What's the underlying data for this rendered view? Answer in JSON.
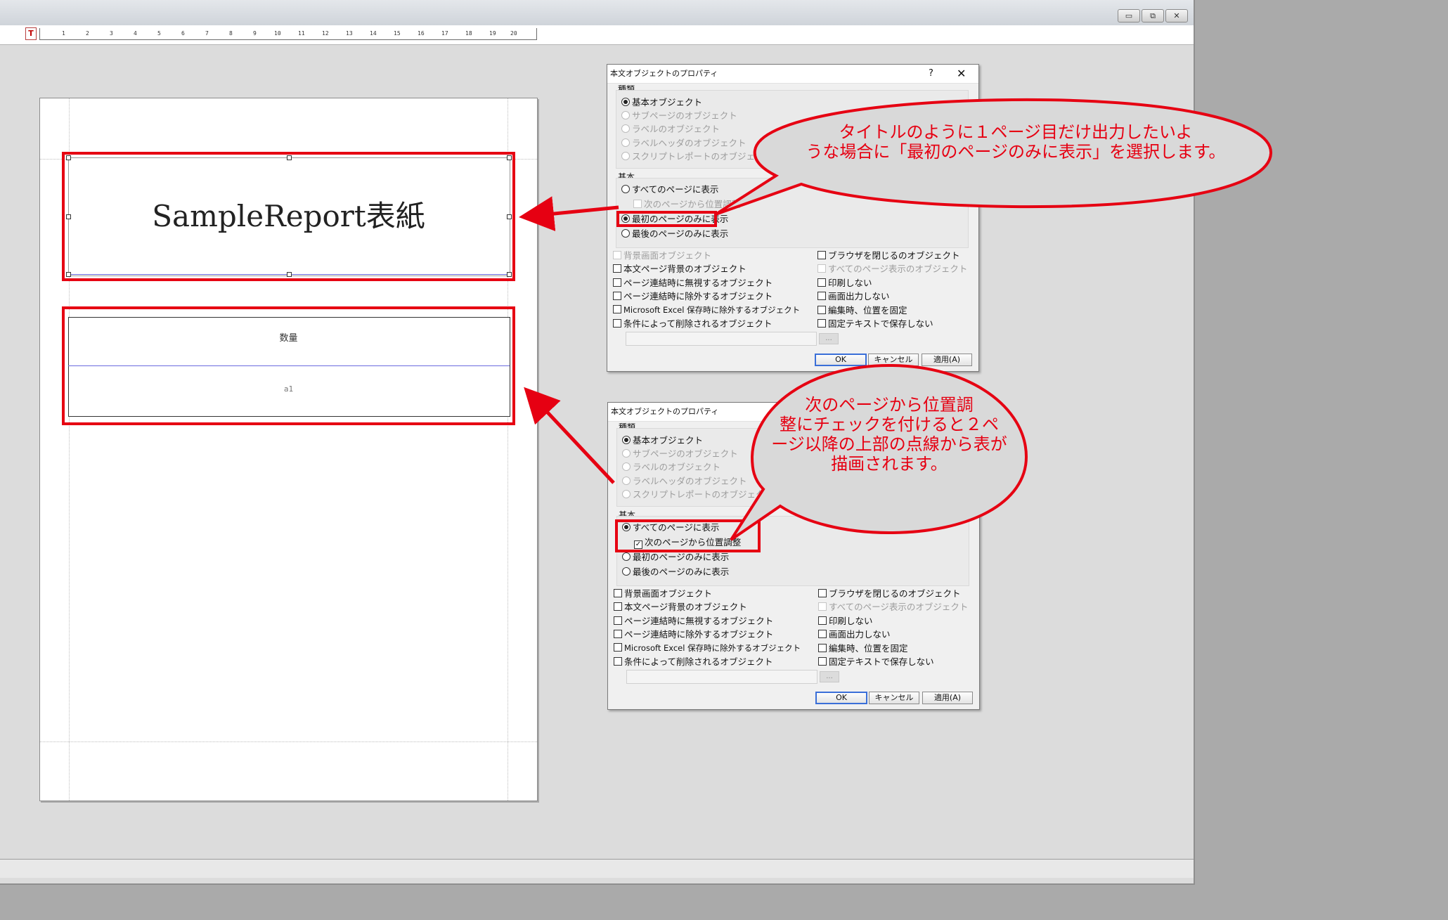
{
  "window": {
    "minimize_glyph": "▭",
    "restore_glyph": "⧉",
    "close_glyph": "✕"
  },
  "ruler": {
    "marker": "T",
    "ticks": [
      "1",
      "2",
      "3",
      "4",
      "5",
      "6",
      "7",
      "8",
      "9",
      "10",
      "11",
      "12",
      "13",
      "14",
      "15",
      "16",
      "17",
      "18",
      "19",
      "20"
    ]
  },
  "report": {
    "title_text": "SampleReport表紙",
    "table_header": "数量",
    "table_cell": "a1"
  },
  "dialog": {
    "title": "本文オブジェクトのプロパティ",
    "help": "?",
    "close": "✕",
    "kind_group": "種類",
    "kind_options": [
      "基本オブジェクト",
      "サブページのオブジェクト",
      "ラベルのオブジェクト",
      "ラベルヘッダのオブジェクト",
      "スクリプトレポートのオブジェクト"
    ],
    "basic_group": "基本",
    "show_all_pages": "すべてのページに表示",
    "adjust_from_next": "次のページから位置調整",
    "first_page_only": "最初のページのみに表示",
    "last_page_only": "最後のページのみに表示",
    "left_checks": [
      "背景画面オブジェクト",
      "本文ページ背景のオブジェクト",
      "ページ連結時に無視するオブジェクト",
      "ページ連結時に除外するオブジェクト",
      "Microsoft Excel 保存時に除外するオブジェクト",
      "条件によって削除されるオブジェクト"
    ],
    "right_checks": [
      "ブラウザを閉じるのオブジェクト",
      "すべてのページ表示のオブジェクト",
      "印刷しない",
      "画面出力しない",
      "編集時、位置を固定",
      "固定テキストで保存しない"
    ],
    "ellipsis": "...",
    "ok": "OK",
    "cancel": "キャンセル",
    "apply": "適用(A)"
  },
  "callouts": {
    "first_line1": "タイトルのように１ページ目だけ出力したいよ",
    "first_line2": "うな場合に「最初のページのみに表示」を選択します。",
    "second_line1": "次のページから位置調",
    "second_line2": "整にチェックを付けると２ペ",
    "second_line3": "ージ以降の上部の点線から表が",
    "second_line4": "描画されます。"
  },
  "colors": {
    "annotation_red": "#e60012",
    "selection_blue": "#6a6adf"
  }
}
